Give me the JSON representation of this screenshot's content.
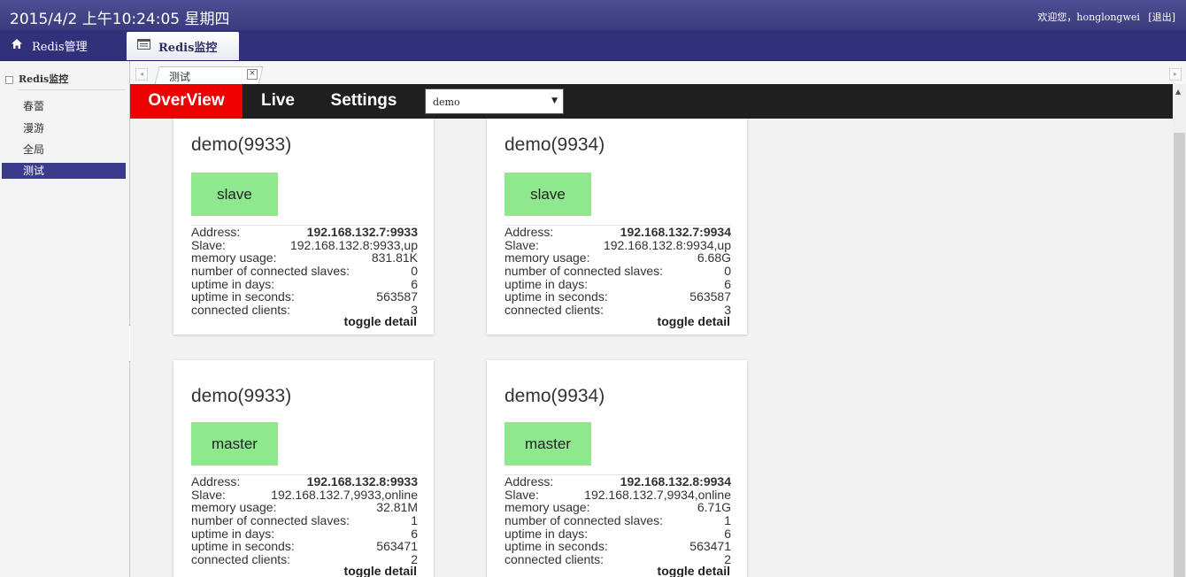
{
  "header": {
    "datetime": "2015/4/2 上午10:24:05 星期四",
    "welcome_prefix": "欢迎您，",
    "username": "honglongwei",
    "logout": "[退出]"
  },
  "nav": {
    "tabs": [
      {
        "label": "Redis管理",
        "icon": "home-icon"
      },
      {
        "label": "Redis监控",
        "icon": "list-window-icon"
      }
    ]
  },
  "sidebar": {
    "title": "Redis监控",
    "items": [
      {
        "label": "春蕾"
      },
      {
        "label": "漫游"
      },
      {
        "label": "全局"
      },
      {
        "label": "测试",
        "active": true
      }
    ]
  },
  "tabstrip": {
    "tab_label": "测试",
    "close": "×"
  },
  "appbar": {
    "tabs": [
      "OverView",
      "Live",
      "Settings"
    ],
    "select_value": "demo"
  },
  "labels": {
    "address": "Address:",
    "slave": "Slave:",
    "memory": "memory usage:",
    "slaves": "number of connected slaves:",
    "days": "uptime in days:",
    "seconds": "uptime in seconds:",
    "clients": "connected clients:",
    "toggle": "toggle detail"
  },
  "cards": [
    {
      "name": "demo(9933)",
      "role": "slave",
      "address": "192.168.132.7:9933",
      "slave": "192.168.132.8:9933,up",
      "memory": "831.81K",
      "slaves": "0",
      "days": "6",
      "seconds": "563587",
      "clients": "3"
    },
    {
      "name": "demo(9934)",
      "role": "slave",
      "address": "192.168.132.7:9934",
      "slave": "192.168.132.8:9934,up",
      "memory": "6.68G",
      "slaves": "0",
      "days": "6",
      "seconds": "563587",
      "clients": "3"
    },
    {
      "name": "demo(9933)",
      "role": "master",
      "address": "192.168.132.8:9933",
      "slave": "192.168.132.7,9933,online",
      "memory": "32.81M",
      "slaves": "1",
      "days": "6",
      "seconds": "563471",
      "clients": "2"
    },
    {
      "name": "demo(9934)",
      "role": "master",
      "address": "192.168.132.8:9934",
      "slave": "192.168.132.7,9934,online",
      "memory": "6.71G",
      "slaves": "1",
      "days": "6",
      "seconds": "563471",
      "clients": "2"
    }
  ],
  "colors": {
    "header_bg": "#3f4086",
    "active_tab": "#ee0000",
    "role_badge": "#8ee88e",
    "sidebar_active": "#3a3b8c"
  }
}
